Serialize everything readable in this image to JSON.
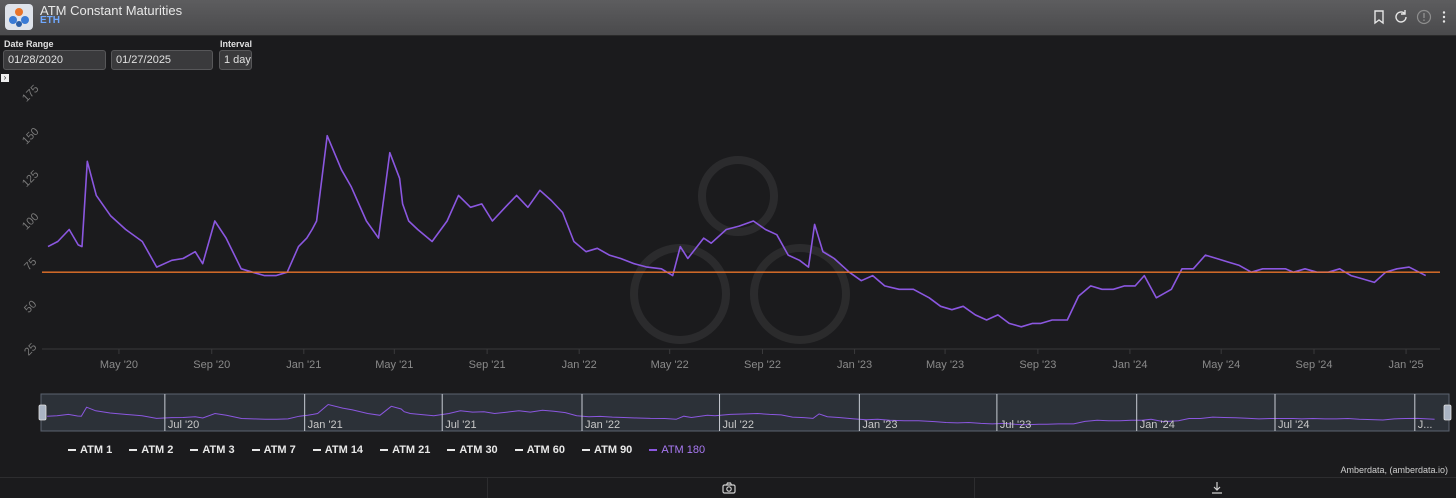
{
  "app": {
    "title": "ATM Constant Maturities",
    "subtitle": "ETH"
  },
  "controls": {
    "date_range_label": "Date Range",
    "start_date": "01/28/2020",
    "end_date": "01/27/2025",
    "interval_label": "Interval",
    "interval": "1 day"
  },
  "expand_glyph": "›",
  "colors": {
    "series": "#8b57e0",
    "reference_line": "#e8742a",
    "background": "#1b1b1d"
  },
  "chart_data": {
    "type": "line",
    "ylim": [
      25,
      175
    ],
    "yticks": [
      "25",
      "50",
      "75",
      "100",
      "125",
      "150",
      "175"
    ],
    "xticks": [
      "May '20",
      "Sep '20",
      "Jan '21",
      "May '21",
      "Sep '21",
      "Jan '22",
      "May '22",
      "Sep '22",
      "Jan '23",
      "May '23",
      "Sep '23",
      "Jan '24",
      "May '24",
      "Sep '24",
      "Jan '25"
    ],
    "reference_line": 70,
    "series": [
      {
        "name": "ATM 180",
        "x": [
          "2020-01-28",
          "2020-02-10",
          "2020-02-25",
          "2020-03-08",
          "2020-03-13",
          "2020-03-20",
          "2020-04-01",
          "2020-04-20",
          "2020-05-10",
          "2020-06-01",
          "2020-06-20",
          "2020-07-10",
          "2020-07-25",
          "2020-08-10",
          "2020-08-20",
          "2020-09-05",
          "2020-09-20",
          "2020-10-10",
          "2020-10-25",
          "2020-11-10",
          "2020-11-25",
          "2020-12-10",
          "2020-12-25",
          "2021-01-05",
          "2021-01-12",
          "2021-01-18",
          "2021-02-01",
          "2021-02-20",
          "2021-03-05",
          "2021-03-25",
          "2021-04-10",
          "2021-04-25",
          "2021-05-08",
          "2021-05-12",
          "2021-05-20",
          "2021-06-01",
          "2021-06-20",
          "2021-07-10",
          "2021-07-25",
          "2021-08-10",
          "2021-08-25",
          "2021-09-08",
          "2021-09-25",
          "2021-10-10",
          "2021-10-25",
          "2021-11-10",
          "2021-11-25",
          "2021-12-10",
          "2021-12-25",
          "2022-01-10",
          "2022-01-25",
          "2022-02-10",
          "2022-02-25",
          "2022-03-15",
          "2022-04-01",
          "2022-04-20",
          "2022-05-05",
          "2022-05-15",
          "2022-05-25",
          "2022-06-15",
          "2022-06-25",
          "2022-07-15",
          "2022-08-01",
          "2022-08-20",
          "2022-09-05",
          "2022-09-20",
          "2022-10-05",
          "2022-10-20",
          "2022-11-01",
          "2022-11-09",
          "2022-11-20",
          "2022-12-05",
          "2022-12-25",
          "2023-01-10",
          "2023-01-25",
          "2023-02-10",
          "2023-03-01",
          "2023-03-20",
          "2023-04-10",
          "2023-04-25",
          "2023-05-10",
          "2023-05-25",
          "2023-06-10",
          "2023-06-25",
          "2023-07-10",
          "2023-07-25",
          "2023-08-10",
          "2023-08-25",
          "2023-09-05",
          "2023-09-20",
          "2023-10-10",
          "2023-10-25",
          "2023-11-10",
          "2023-11-25",
          "2023-12-10",
          "2023-12-25",
          "2024-01-08",
          "2024-01-20",
          "2024-02-05",
          "2024-02-25",
          "2024-03-10",
          "2024-03-25",
          "2024-04-10",
          "2024-04-25",
          "2024-05-10",
          "2024-05-25",
          "2024-06-10",
          "2024-06-25",
          "2024-07-10",
          "2024-07-25",
          "2024-08-05",
          "2024-08-20",
          "2024-09-05",
          "2024-09-20",
          "2024-10-05",
          "2024-10-20",
          "2024-11-05",
          "2024-11-20",
          "2024-12-05",
          "2024-12-20",
          "2025-01-05",
          "2025-01-27"
        ],
        "y": [
          85,
          88,
          95,
          86,
          85,
          135,
          115,
          103,
          95,
          88,
          73,
          77,
          78,
          82,
          75,
          100,
          90,
          72,
          70,
          68,
          68,
          70,
          85,
          90,
          95,
          100,
          150,
          130,
          120,
          100,
          90,
          140,
          125,
          110,
          100,
          95,
          88,
          100,
          115,
          108,
          110,
          100,
          108,
          115,
          108,
          118,
          112,
          105,
          88,
          82,
          84,
          80,
          78,
          75,
          73,
          72,
          68,
          85,
          78,
          90,
          87,
          95,
          97,
          100,
          95,
          92,
          80,
          77,
          73,
          98,
          82,
          78,
          70,
          65,
          68,
          62,
          60,
          60,
          55,
          50,
          48,
          50,
          45,
          42,
          45,
          40,
          38,
          40,
          40,
          42,
          42,
          56,
          62,
          60,
          60,
          62,
          62,
          68,
          55,
          60,
          72,
          72,
          80,
          78,
          76,
          74,
          70,
          72,
          72,
          72,
          70,
          72,
          70,
          70,
          72,
          68,
          66,
          64,
          70,
          72,
          73,
          68
        ]
      }
    ]
  },
  "navigator": {
    "ticks": [
      "Jul '20",
      "Jan '21",
      "Jul '21",
      "Jan '22",
      "Jul '22",
      "Jan '23",
      "Jul '23",
      "Jan '24",
      "Jul '24",
      "J..."
    ]
  },
  "legend": [
    "ATM 1",
    "ATM 2",
    "ATM 3",
    "ATM 7",
    "ATM 14",
    "ATM 21",
    "ATM 30",
    "ATM 60",
    "ATM 90",
    "ATM 180"
  ],
  "credit": "Amberdata, (amberdata.io)"
}
